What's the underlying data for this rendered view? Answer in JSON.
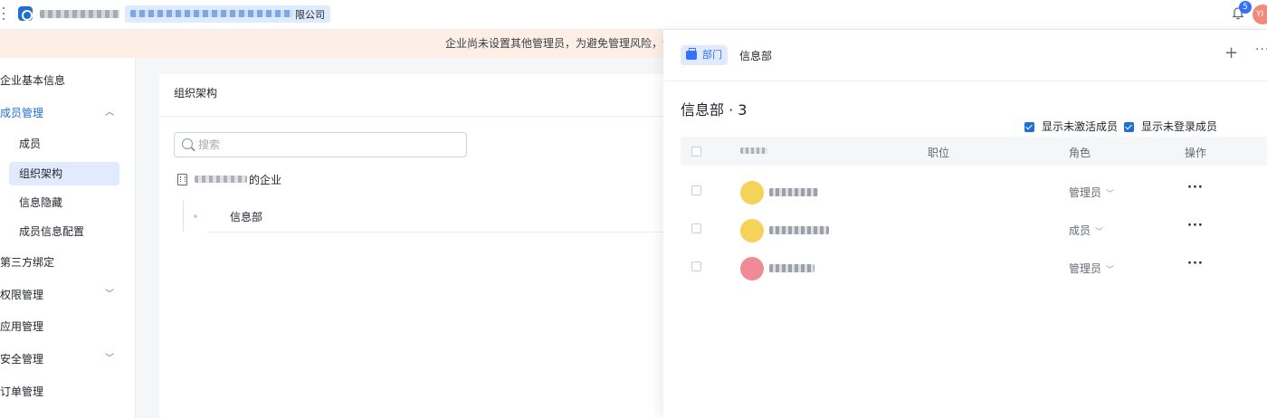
{
  "topbar": {
    "tenant_suffix": "限公司",
    "notification_count": "5",
    "user_initials": "YI"
  },
  "banner": {
    "text": "企业尚未设置其他管理员，为避免管理风险，请及"
  },
  "sidebar": {
    "items": [
      {
        "label": "企业基本信息"
      },
      {
        "label": "成员管理"
      },
      {
        "label": "第三方绑定"
      },
      {
        "label": "权限管理"
      },
      {
        "label": "应用管理"
      },
      {
        "label": "安全管理"
      },
      {
        "label": "订单管理"
      }
    ],
    "member_sub": [
      {
        "label": "成员"
      },
      {
        "label": "组织架构"
      },
      {
        "label": "信息隐藏"
      },
      {
        "label": "成员信息配置"
      }
    ]
  },
  "main": {
    "card_title": "组织架构",
    "search_placeholder": "搜索",
    "org_root_suffix": "的企业",
    "org_child": "信息部"
  },
  "drawer": {
    "tag_label": "部门",
    "dept_name": "信息部",
    "title": "信息部 · 3",
    "filters": [
      {
        "label": "显示未激活成员",
        "checked": true
      },
      {
        "label": "显示未登录成员",
        "checked": true
      }
    ],
    "columns": {
      "position": "职位",
      "role": "角色",
      "actions": "操作"
    },
    "rows": [
      {
        "role": "管理员",
        "avatar_color": "#f5d35a"
      },
      {
        "role": "成员",
        "avatar_color": "#f5d35a"
      },
      {
        "role": "管理员",
        "avatar_color": "#ef8a97"
      }
    ]
  }
}
